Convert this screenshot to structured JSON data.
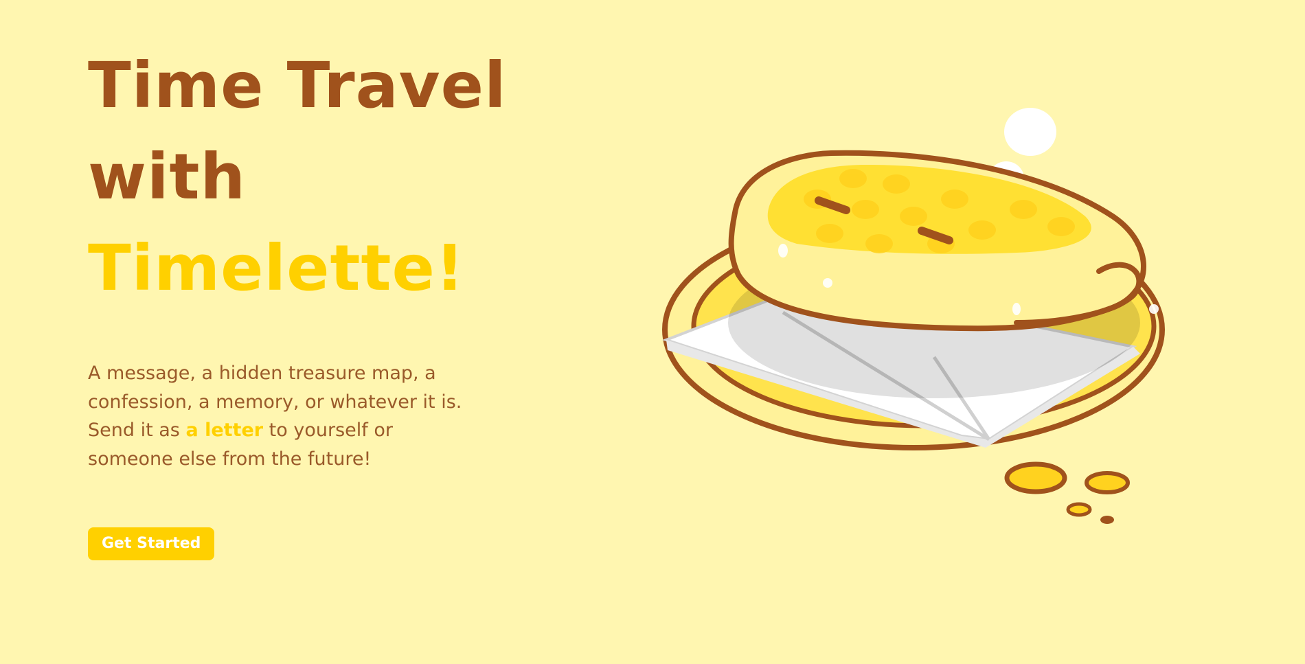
{
  "hero": {
    "headline_line1": "Time Travel",
    "headline_line2": "with",
    "headline_line3": "Timelette!",
    "description_part1": "A message, a hidden treasure map, a confession, a memory, or whatever it is. Send it as ",
    "description_highlight": "a letter",
    "description_part2": " to yourself or someone else from the future!",
    "cta_label": "Get Started"
  },
  "colors": {
    "background": "#fff6b0",
    "headline_brown": "#a0521c",
    "accent_yellow": "#ffd000",
    "body_text": "#9a5a2a"
  },
  "illustration": {
    "icon": "pancake-letter-mascot-illustration"
  }
}
